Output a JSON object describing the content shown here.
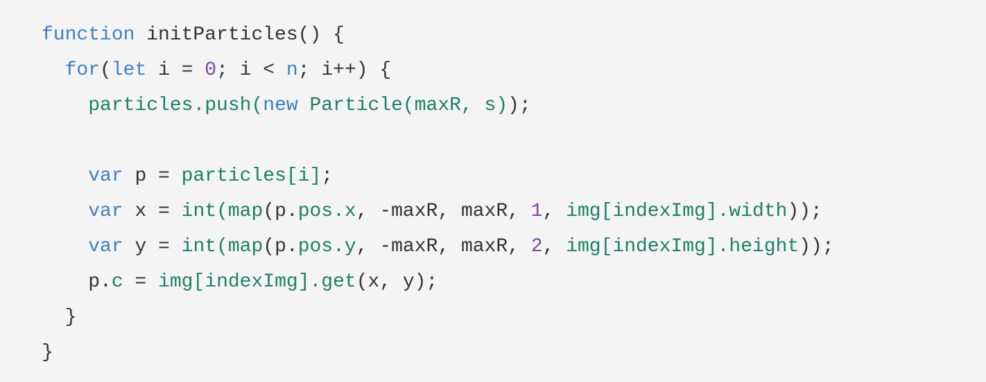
{
  "code": {
    "colors": {
      "keyword": "#3f7fc1",
      "identifier": "#1d8062",
      "number": "#7a4a9a",
      "default": "#333333",
      "background": "#f4f4f4"
    },
    "lines": [
      [
        [
          "function",
          "k"
        ],
        [
          " initParticles() {",
          "d"
        ]
      ],
      [
        [
          "  ",
          "d"
        ],
        [
          "for",
          "k"
        ],
        [
          "(",
          "d"
        ],
        [
          "let",
          "k"
        ],
        [
          " i = ",
          "d"
        ],
        [
          "0",
          "n"
        ],
        [
          "; i < ",
          "d"
        ],
        [
          "n",
          "k"
        ],
        [
          "; i++) {",
          "d"
        ]
      ],
      [
        [
          "    ",
          "d"
        ],
        [
          "particles.push(",
          "g"
        ],
        [
          "new",
          "k"
        ],
        [
          " Particle(maxR, s)",
          "g"
        ],
        [
          ");",
          "d"
        ]
      ],
      [],
      [
        [
          "    ",
          "d"
        ],
        [
          "var",
          "k"
        ],
        [
          " p = ",
          "d"
        ],
        [
          "particles[i]",
          "g"
        ],
        [
          ";",
          "d"
        ]
      ],
      [
        [
          "    ",
          "d"
        ],
        [
          "var",
          "k"
        ],
        [
          " x = ",
          "d"
        ],
        [
          "int(map",
          "g"
        ],
        [
          "(p.",
          "d"
        ],
        [
          "pos.x",
          "g"
        ],
        [
          ", -maxR, maxR, ",
          "d"
        ],
        [
          "1",
          "n"
        ],
        [
          ", ",
          "d"
        ],
        [
          "img[indexImg].width",
          "g"
        ],
        [
          "));",
          "d"
        ]
      ],
      [
        [
          "    ",
          "d"
        ],
        [
          "var",
          "k"
        ],
        [
          " y = ",
          "d"
        ],
        [
          "int(map",
          "g"
        ],
        [
          "(p.",
          "d"
        ],
        [
          "pos.y",
          "g"
        ],
        [
          ", -maxR, maxR, ",
          "d"
        ],
        [
          "2",
          "n"
        ],
        [
          ", ",
          "d"
        ],
        [
          "img[indexImg].height",
          "g"
        ],
        [
          "));",
          "d"
        ]
      ],
      [
        [
          "    p.",
          "d"
        ],
        [
          "c",
          "g"
        ],
        [
          " = ",
          "d"
        ],
        [
          "img[indexImg].get",
          "g"
        ],
        [
          "(x, y);",
          "d"
        ]
      ],
      [
        [
          "  }",
          "d"
        ]
      ],
      [
        [
          "}",
          "d"
        ]
      ]
    ]
  }
}
